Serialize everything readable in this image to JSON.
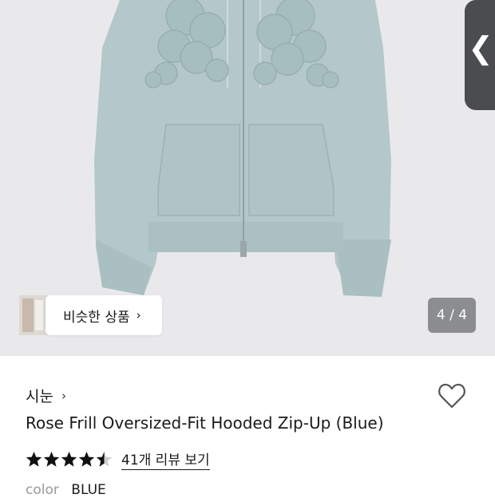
{
  "gallery": {
    "counter": "4 / 4",
    "side_handle_glyph": "❮",
    "similar_products_label": "비슷한 상품",
    "similar_chevron": "›"
  },
  "product": {
    "brand": "시눈",
    "brand_chevron": "›",
    "title": "Rose Frill Oversized-Fit Hooded Zip-Up (Blue)",
    "rating": 4.5,
    "review_link": "41개 리뷰 보기",
    "color_label": "color",
    "color_value": "BLUE"
  },
  "colors": {
    "hoodie": "#b4c8cb",
    "background": "#e9e9eb",
    "star": "#111111"
  },
  "icons": {
    "heart": "heart-icon",
    "star": "star-icon"
  }
}
